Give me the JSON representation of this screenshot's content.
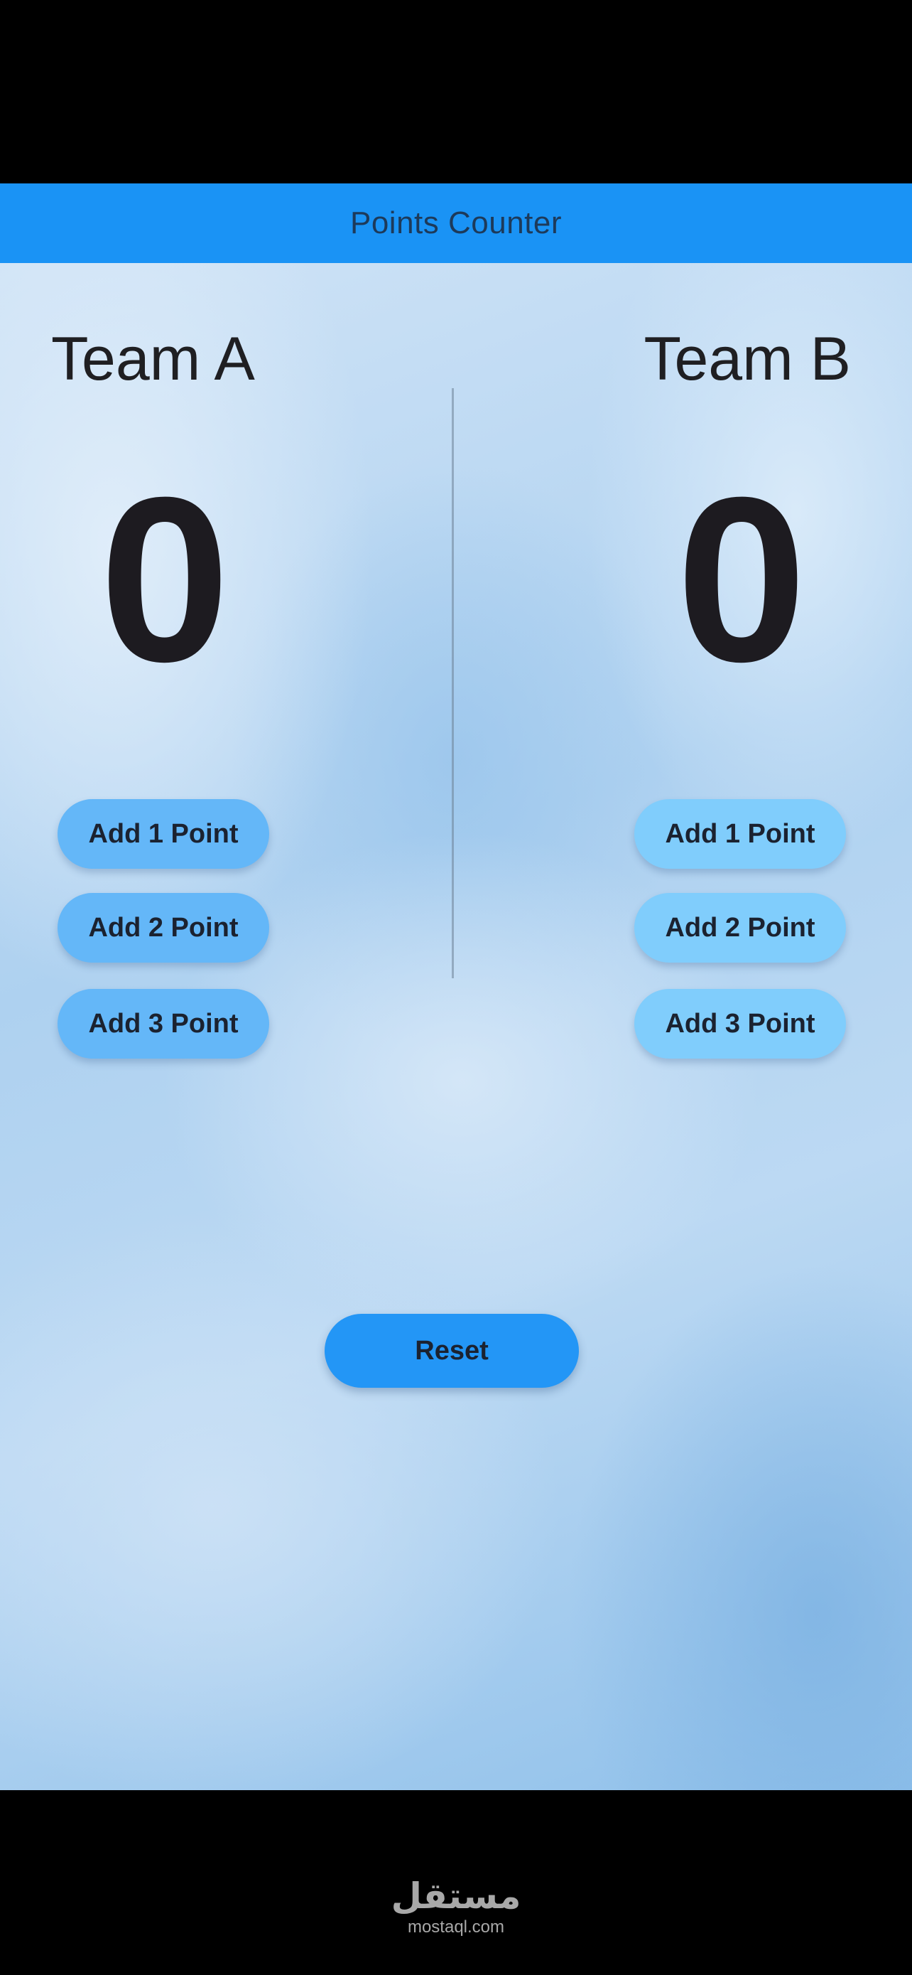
{
  "appbar": {
    "title": "Points Counter",
    "color": "#1a93f5"
  },
  "team_a": {
    "name": "Team A",
    "score": "0",
    "buttons": [
      "Add 1 Point",
      "Add 2 Point",
      "Add 3 Point"
    ],
    "button_color": "#64b7f8"
  },
  "team_b": {
    "name": "Team B",
    "score": "0",
    "buttons": [
      "Add 1 Point",
      "Add 2 Point",
      "Add 3 Point"
    ],
    "button_color": "#80cdfc"
  },
  "reset": {
    "label": "Reset",
    "color": "#2396f6"
  },
  "watermark": {
    "logo": "مستقل",
    "url": "mostaql.com"
  }
}
